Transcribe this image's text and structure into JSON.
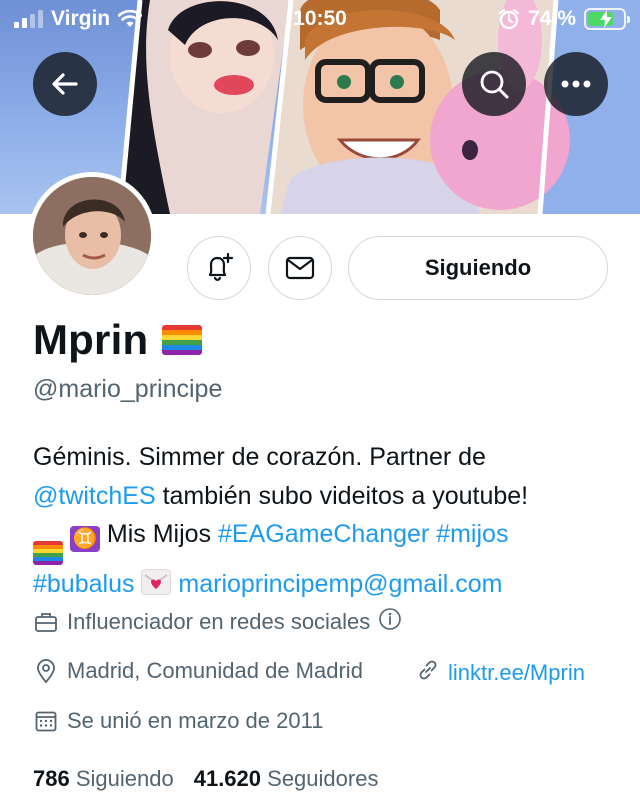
{
  "status_bar": {
    "carrier": "Virgin",
    "time": "10:50",
    "battery_percent": "74 %",
    "battery_level": 0.74,
    "icons": [
      "signal-icon",
      "wifi-icon",
      "alarm-icon",
      "battery-icon"
    ]
  },
  "header": {
    "icons": [
      "back-arrow-icon",
      "search-icon",
      "more-icon"
    ]
  },
  "actions": {
    "follow_label": "Siguiendo",
    "icons": [
      "bell-plus-icon",
      "envelope-icon"
    ]
  },
  "profile": {
    "name": "Mprin",
    "handle": "@mario_principe",
    "bio": {
      "line1": "Géminis. Simmer de corazón. Partner de",
      "mention": "@twitchES",
      "line2_rest": " también subo videitos a youtube!",
      "line3_text": " Mis Mijos ",
      "hashtag1": "#EAGameChanger",
      "hashtag2": "#mijos",
      "hashtag3": "#bubalus",
      "email": "marioprincipemp@gmail.com"
    },
    "category": "Influenciador en redes sociales",
    "location": "Madrid, Comunidad de Madrid",
    "website": "linktr.ee/Mprin",
    "joined": "Se unió en marzo de 2011"
  },
  "stats": {
    "following_count": "786",
    "following_label": "Siguiendo",
    "followers_count": "41.620",
    "followers_label": "Seguidores"
  },
  "colors": {
    "accent": "#1d9bf0",
    "text_primary": "#0f1419",
    "text_secondary": "#536471",
    "border": "#cfd9de"
  }
}
